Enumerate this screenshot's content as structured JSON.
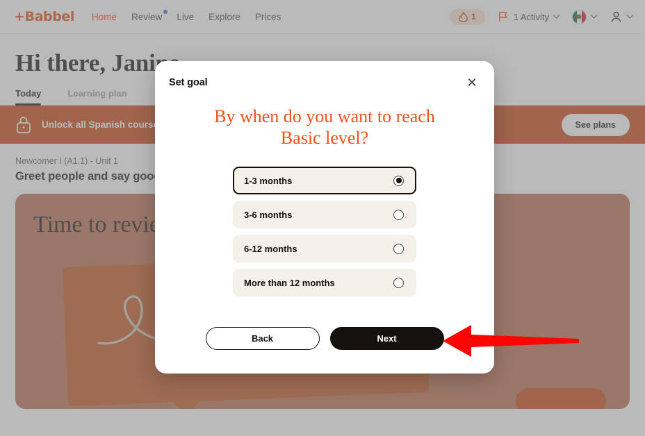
{
  "navbar": {
    "brand": "+Babbel",
    "links": [
      {
        "label": "Home",
        "active": true,
        "badge": false
      },
      {
        "label": "Review",
        "active": false,
        "badge": true
      },
      {
        "label": "Live",
        "active": false,
        "badge": false
      },
      {
        "label": "Explore",
        "active": false,
        "badge": false
      },
      {
        "label": "Prices",
        "active": false,
        "badge": false
      }
    ],
    "streak": {
      "icon": "flame-icon",
      "count": "1"
    },
    "activity": {
      "icon": "flag-icon",
      "label": "1 Activity"
    },
    "language": {
      "icon": "mexico-flag-icon"
    },
    "account": {
      "icon": "user-icon"
    }
  },
  "page": {
    "greeting": "Hi there, Janine",
    "tabs": [
      {
        "label": "Today",
        "active": true
      },
      {
        "label": "Learning plan",
        "active": false
      }
    ],
    "promo": {
      "icon": "lock-icon",
      "text": "Unlock all Spanish courses",
      "button": "See plans"
    },
    "lesson": {
      "eyebrow": "Newcomer I (A1.1) - Unit 1",
      "title": "Greet people and say goodbye"
    },
    "review_card": {
      "title": "Time to review",
      "decoration": "loop-squiggle-icon"
    }
  },
  "modal": {
    "kicker": "Set goal",
    "close_icon": "close-icon",
    "title": "By when do you want to reach Basic level?",
    "options": [
      {
        "label": "1-3 months",
        "selected": true
      },
      {
        "label": "3-6 months",
        "selected": false
      },
      {
        "label": "6-12 months",
        "selected": false
      },
      {
        "label": "More than 12 months",
        "selected": false
      }
    ],
    "back_label": "Back",
    "next_label": "Next"
  },
  "annotation": {
    "arrow": "red-left-arrow",
    "color": "#fb0404",
    "points_to": "Next"
  },
  "colors": {
    "brand_orange": "#e8450c",
    "title_orange": "#f2511b",
    "promo_orange": "#c8400d",
    "card_orange": "#b96a4b",
    "bubble_orange": "#c0501c",
    "option_cream": "#f4f1ea",
    "ink": "#14110f",
    "badge_blue": "#3b6ee0",
    "arrow_red": "#fb0404"
  }
}
